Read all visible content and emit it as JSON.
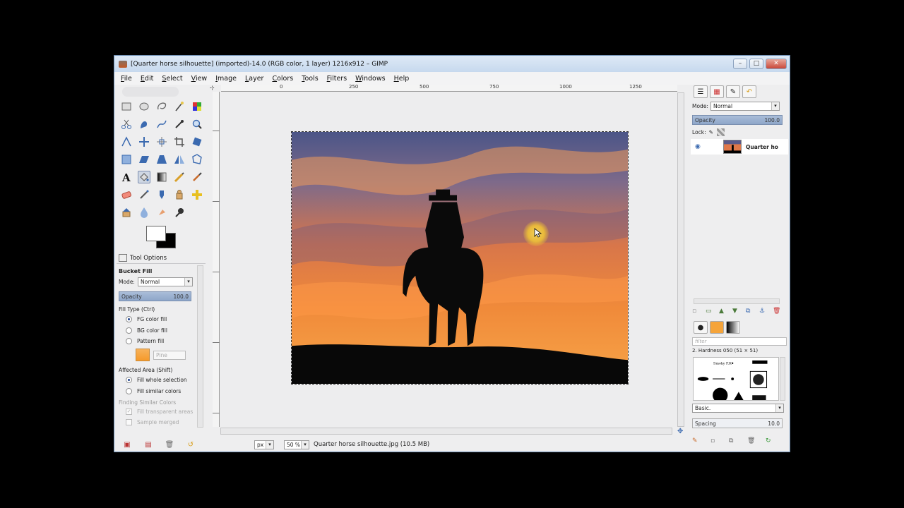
{
  "window": {
    "title": "[Quarter horse silhouette] (imported)-14.0 (RGB color, 1 layer) 1216x912 – GIMP",
    "controls": [
      "–",
      "□",
      "✕"
    ]
  },
  "menubar": [
    "File",
    "Edit",
    "Select",
    "View",
    "Image",
    "Layer",
    "Colors",
    "Tools",
    "Filters",
    "Windows",
    "Help"
  ],
  "ruler": {
    "top_ticks": [
      "0",
      "250",
      "500",
      "750",
      "1000",
      "1250"
    ],
    "left_ticks": [
      "0",
      "250",
      "500",
      "750",
      "1000"
    ]
  },
  "tool_options": {
    "tab_label": "Tool Options",
    "tool_name": "Bucket Fill",
    "mode_label": "Mode:",
    "mode_value": "Normal",
    "opacity_label": "Opacity",
    "opacity_value": "100.0",
    "fill_type_label": "Fill Type  (Ctrl)",
    "fill_types": [
      "FG color fill",
      "BG color fill",
      "Pattern fill"
    ],
    "pattern_name": "Pine",
    "affected_label": "Affected Area  (Shift)",
    "affected": [
      "Fill whole selection",
      "Fill similar colors"
    ],
    "finding_label": "Finding Similar Colors",
    "fill_transparent": "Fill transparent areas",
    "sample_merged": "Sample merged"
  },
  "status": {
    "unit": "px",
    "zoom": "50 %",
    "file_info": "Quarter horse silhouette.jpg (10.5 MB)"
  },
  "layers": {
    "mode_label": "Mode:",
    "mode_value": "Normal",
    "opacity_label": "Opacity",
    "opacity_value": "100.0",
    "lock_label": "Lock:",
    "layer_name": "Quarter ho"
  },
  "brushes": {
    "filter_placeholder": "filter",
    "brush_name": "2. Hardness 050 (51 × 51)",
    "preset": "Basic.",
    "spacing_label": "Spacing",
    "spacing_value": "10.0"
  },
  "colors": {
    "accent": "#8ea6c9",
    "sky_top": "#4e5a8e",
    "sky_orange": "#f28a3a",
    "fg": "#ffffff",
    "bg": "#000000"
  }
}
